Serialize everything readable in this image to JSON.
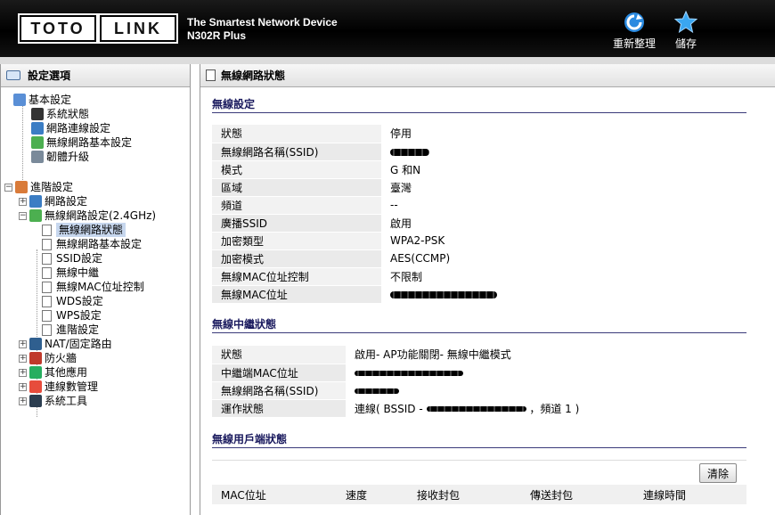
{
  "header": {
    "logo_left": "TOTO",
    "logo_right": "LINK",
    "tagline": "The Smartest Network Device",
    "model": "N302R Plus",
    "reboot_label": "重新整理",
    "save_label": "儲存",
    "colors": {
      "bg": "#000000",
      "icon_blue": "#2a8ae0"
    }
  },
  "sidebar": {
    "title": "設定選項",
    "basic": {
      "label": "基本設定",
      "items": [
        "系統狀態",
        "網路連線設定",
        "無線網路基本設定",
        "韌體升級"
      ]
    },
    "advanced": {
      "label": "進階設定",
      "items": [
        {
          "label": "網路設定"
        },
        {
          "label": "無線網路設定(2.4GHz)",
          "children": [
            "無線網路狀態",
            "無線網路基本設定",
            "SSID設定",
            "無線中繼",
            "無線MAC位址控制",
            "WDS設定",
            "WPS設定",
            "進階設定"
          ]
        },
        {
          "label": "NAT/固定路由"
        },
        {
          "label": "防火牆"
        },
        {
          "label": "其他應用"
        },
        {
          "label": "連線數管理"
        },
        {
          "label": "系統工具"
        }
      ],
      "selected": "無線網路狀態"
    }
  },
  "main": {
    "title": "無線網路狀態",
    "wireless": {
      "title": "無線設定",
      "rows": [
        {
          "k": "狀態",
          "v": "停用"
        },
        {
          "k": "無線網路名稱(SSID)",
          "v": ""
        },
        {
          "k": "模式",
          "v": "G 和N"
        },
        {
          "k": "區域",
          "v": "臺灣"
        },
        {
          "k": "頻道",
          "v": "--"
        },
        {
          "k": "廣播SSID",
          "v": "啟用"
        },
        {
          "k": "加密類型",
          "v": "WPA2-PSK"
        },
        {
          "k": "加密模式",
          "v": "AES(CCMP)"
        },
        {
          "k": "無線MAC位址控制",
          "v": "不限制"
        },
        {
          "k": "無線MAC位址",
          "v": ""
        }
      ]
    },
    "repeater": {
      "title": "無線中繼狀態",
      "rows": [
        {
          "k": "狀態",
          "v": "啟用- AP功能關閉- 無線中繼模式"
        },
        {
          "k": "中繼端MAC位址",
          "v": ""
        },
        {
          "k": "無線網路名稱(SSID)",
          "v": ""
        },
        {
          "k": "運作狀態",
          "v_prefix": "連線( BSSID -",
          "v_suffix": "，頻道 1 )"
        }
      ]
    },
    "clients": {
      "title": "無線用戶端狀態",
      "clear_label": "清除",
      "columns": [
        "MAC位址",
        "速度",
        "接收封包",
        "傳送封包",
        "連線時間"
      ]
    }
  }
}
